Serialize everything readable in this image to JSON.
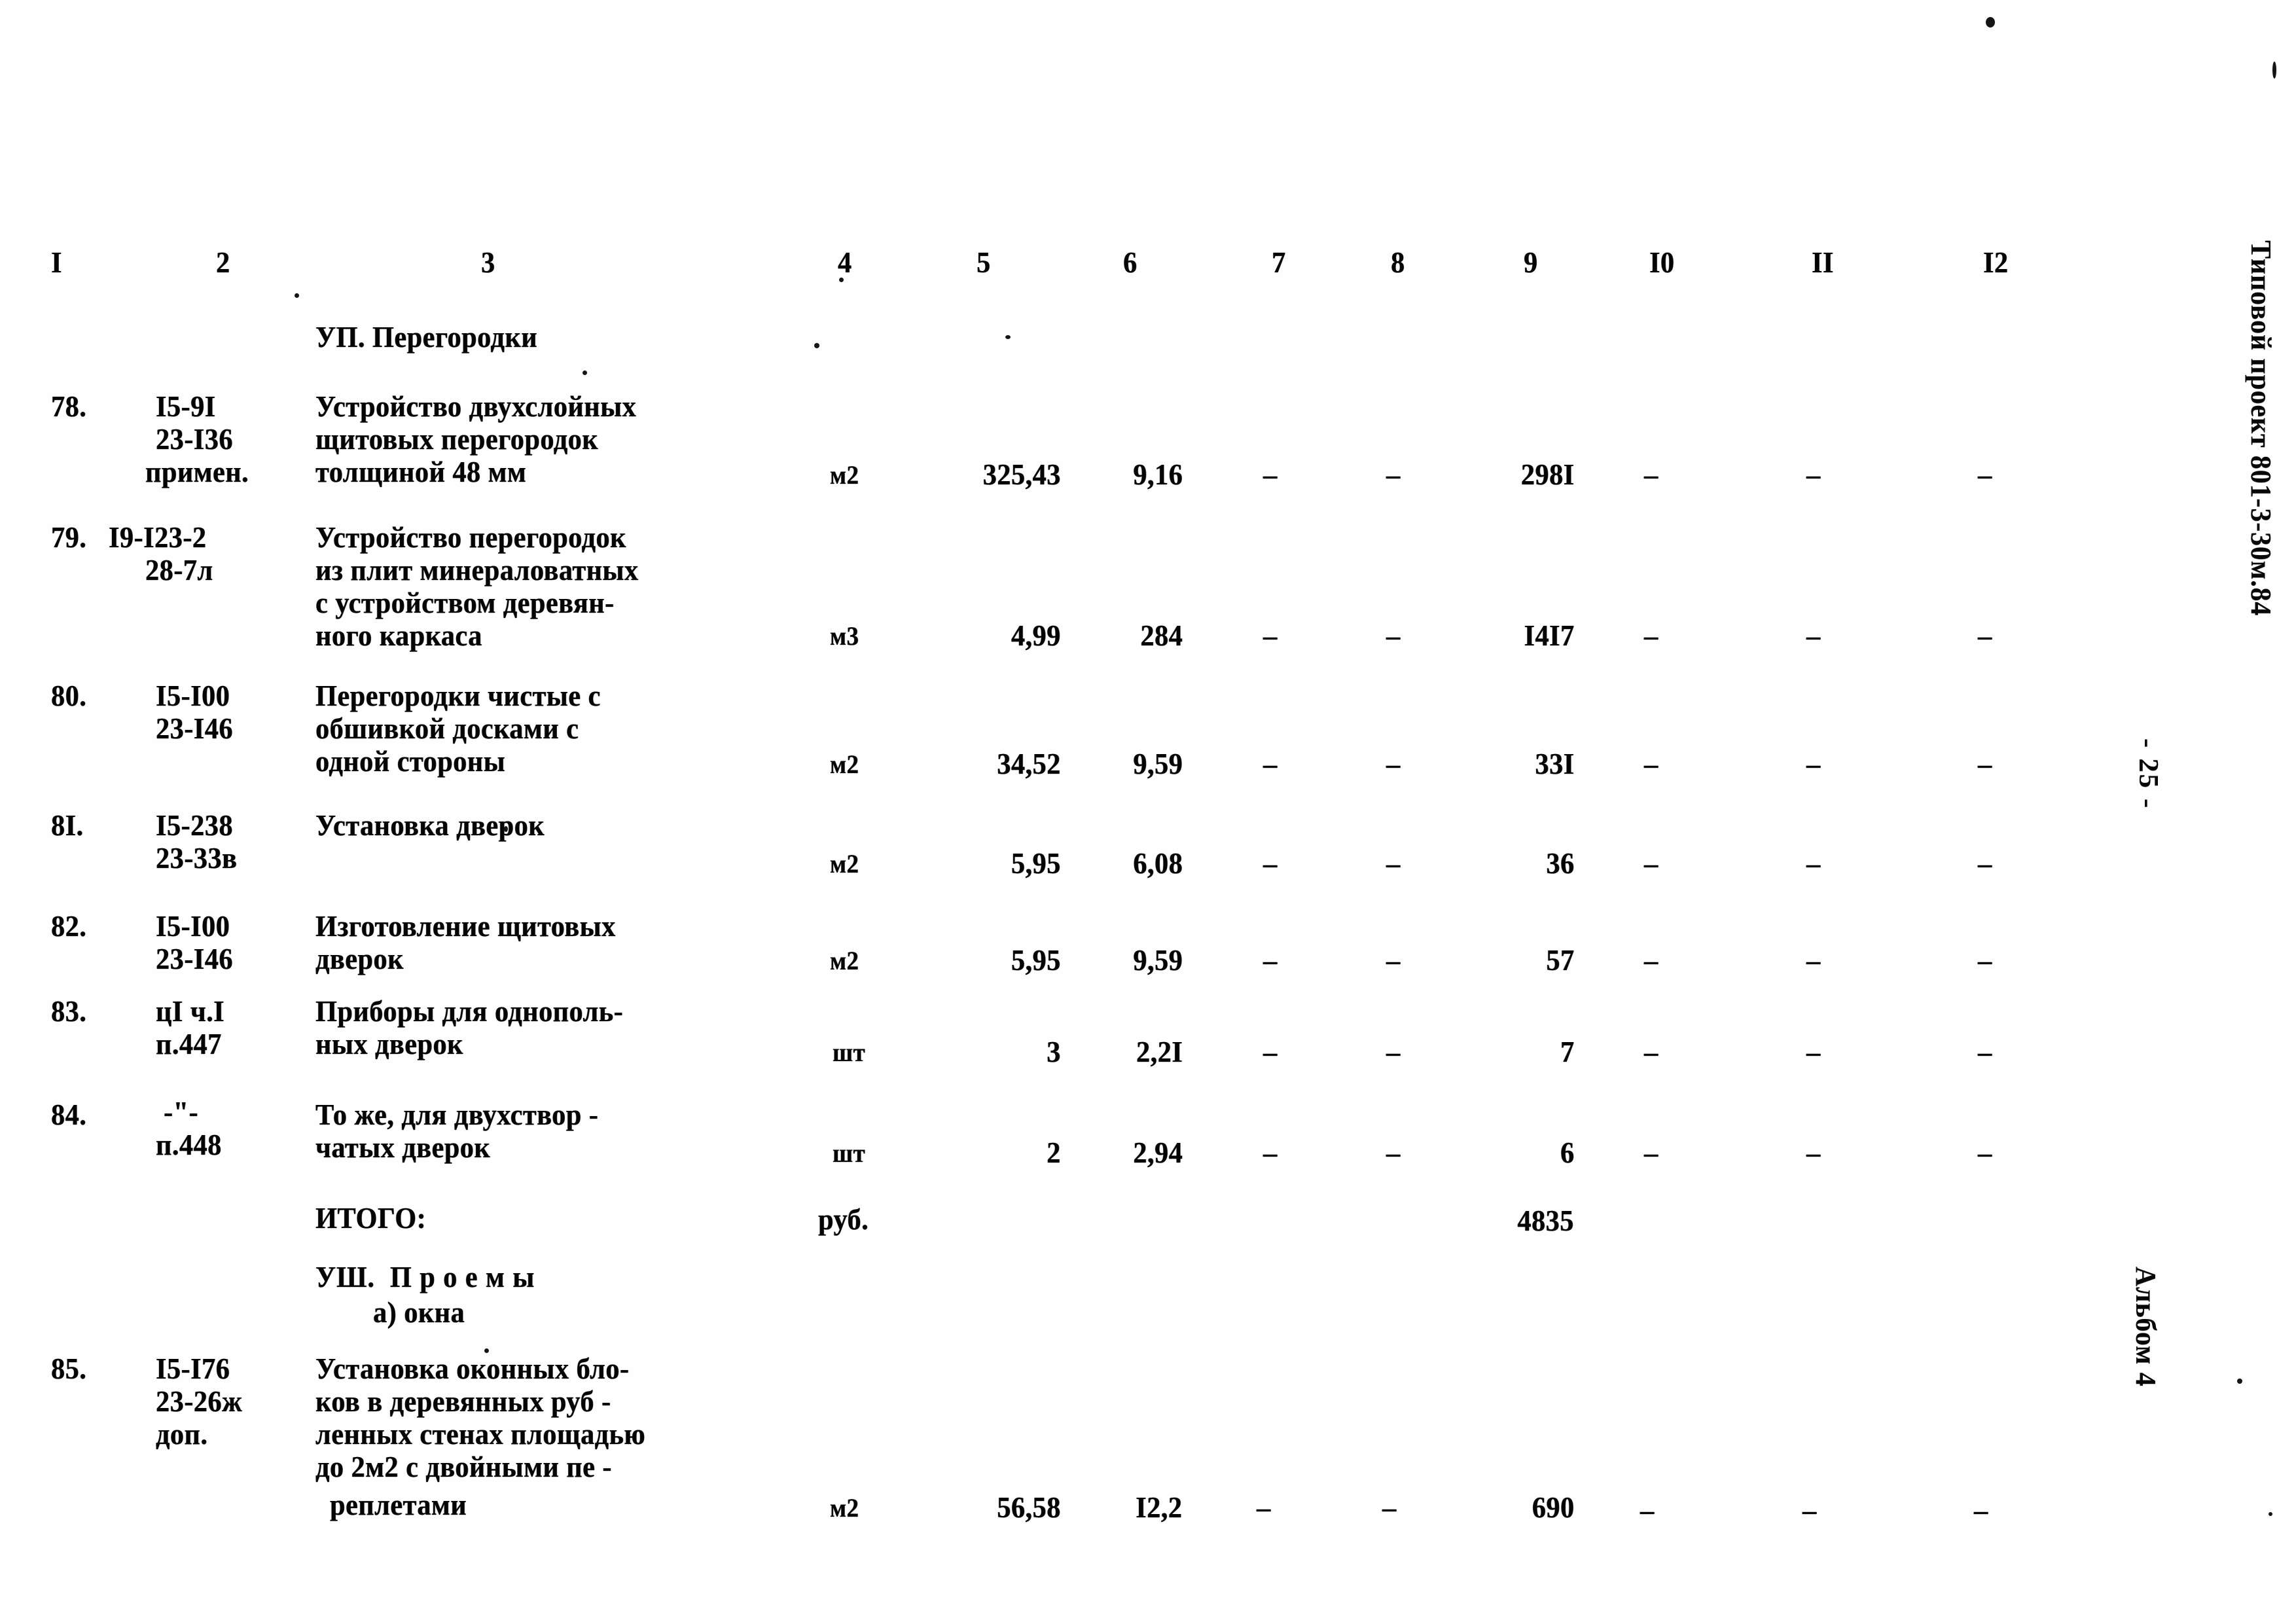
{
  "document": {
    "project_title_vertical": "Типовой проект 801-3-30м.84",
    "album_vertical": "Альбом 4",
    "page_number_vertical": "- 25 -"
  },
  "table": {
    "column_headers": [
      "I",
      "2",
      "3",
      "4",
      "5",
      "6",
      "7",
      "8",
      "9",
      "I0",
      "II",
      "I2"
    ],
    "section_headings": [
      {
        "id": "s1",
        "text": "УП. Перегородки"
      },
      {
        "id": "s2",
        "text": "УШ.  П р о е м ы"
      },
      {
        "id": "s3",
        "text": "а) окна"
      }
    ],
    "total_label": "ИТОГО:",
    "total_unit": "руб.",
    "total_value": "4835",
    "dash": "–",
    "rows": [
      {
        "no": "78.",
        "code_lines": [
          "I5-9I",
          "23-I36",
          "примен."
        ],
        "desc_lines": [
          "Устройство двухслойных",
          "щитовых перегородок",
          "толщиной 48 мм"
        ],
        "unit": "м2",
        "qty": "325,43",
        "price": "9,16",
        "c7": "–",
        "c8": "–",
        "sum": "298I",
        "c10": "–",
        "c11": "–",
        "c12": "–"
      },
      {
        "no": "79.",
        "code_lines": [
          "I9-I23-2",
          "28-7л"
        ],
        "desc_lines": [
          "Устройство перегородок",
          "из плит минераловатных",
          "с устройством деревян-",
          "ного каркаса"
        ],
        "unit": "м3",
        "qty": "4,99",
        "price": "284",
        "c7": "–",
        "c8": "–",
        "sum": "I4I7",
        "c10": "–",
        "c11": "–",
        "c12": "–"
      },
      {
        "no": "80.",
        "code_lines": [
          "I5-I00",
          "23-I46"
        ],
        "desc_lines": [
          "Перегородки чистые с",
          "обшивкой досками с",
          "одной стороны"
        ],
        "unit": "м2",
        "qty": "34,52",
        "price": "9,59",
        "c7": "–",
        "c8": "–",
        "sum": "33I",
        "c10": "–",
        "c11": "–",
        "c12": "–"
      },
      {
        "no": "8I.",
        "code_lines": [
          "I5-238",
          "23-33в"
        ],
        "desc_lines": [
          "Установка дверок"
        ],
        "unit": "м2",
        "qty": "5,95",
        "price": "6,08",
        "c7": "–",
        "c8": "–",
        "sum": "36",
        "c10": "–",
        "c11": "–",
        "c12": "–"
      },
      {
        "no": "82.",
        "code_lines": [
          "I5-I00",
          "23-I46"
        ],
        "desc_lines": [
          "Изготовление щитовых",
          "дверок"
        ],
        "unit": "м2",
        "qty": "5,95",
        "price": "9,59",
        "c7": "–",
        "c8": "–",
        "sum": "57",
        "c10": "–",
        "c11": "–",
        "c12": "–"
      },
      {
        "no": "83.",
        "code_lines": [
          "цI ч.I",
          "п.447"
        ],
        "desc_lines": [
          "Приборы для однополь-",
          "ных дверок"
        ],
        "unit": "шт",
        "qty": "3",
        "price": "2,2I",
        "c7": "–",
        "c8": "–",
        "sum": "7",
        "c10": "–",
        "c11": "–",
        "c12": "–"
      },
      {
        "no": "84.",
        "code_lines": [
          "-\"-",
          "п.448"
        ],
        "desc_lines": [
          "То же, для двухствор -",
          "чатых дверок"
        ],
        "unit": "шт",
        "qty": "2",
        "price": "2,94",
        "c7": "–",
        "c8": "–",
        "sum": "6",
        "c10": "–",
        "c11": "–",
        "c12": "–"
      },
      {
        "no": "85.",
        "code_lines": [
          "I5-I76",
          "23-26ж",
          "доп."
        ],
        "desc_lines": [
          "Установка оконных бло-",
          "ков в деревянных руб -",
          "ленных стенах площадью",
          "до 2м2 с двойными пе -",
          "реплетами"
        ],
        "unit": "м2",
        "qty": "56,58",
        "price": "I2,2",
        "c7": "–",
        "c8": "–",
        "sum": "690",
        "c10": "–",
        "c11": "–",
        "c12": "–"
      }
    ]
  }
}
